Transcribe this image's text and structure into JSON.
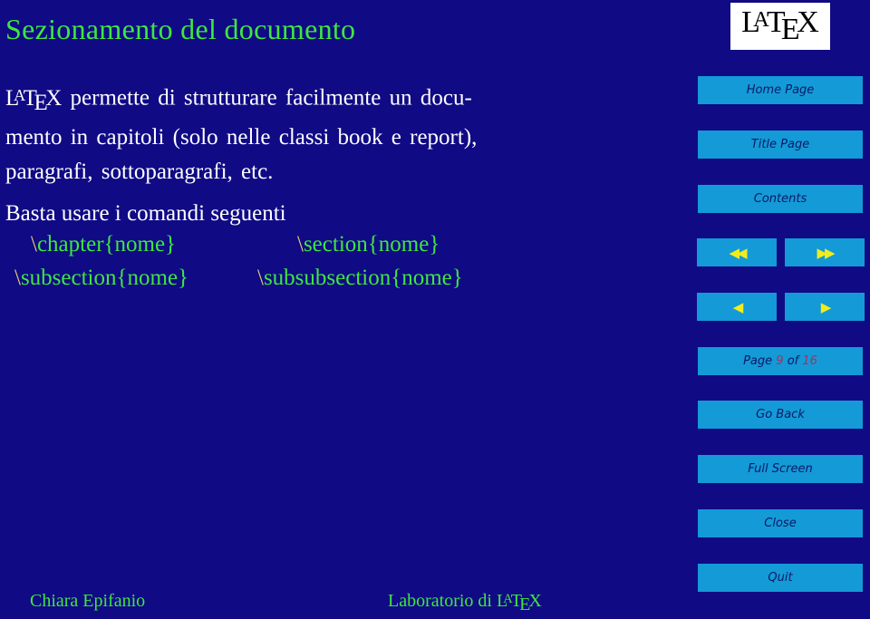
{
  "slide": {
    "title": "Sezionamento del documento",
    "logo": {
      "l": "L",
      "a": "A",
      "t": "T",
      "e": "E",
      "x": "X"
    },
    "paragraph": {
      "line1_rest": " permette di strutturare facilmente un docu-",
      "line2": "mento in capitoli (solo nelle classi book e report),",
      "line3": "paragrafi, sottoparagrafi, etc."
    },
    "intro": "Basta usare i comandi seguenti",
    "commands": [
      {
        "backslash": "\\",
        "name": "chapter{nome}"
      },
      {
        "backslash": "\\",
        "name": "section{nome}"
      },
      {
        "backslash": "\\",
        "name": "subsection{nome}"
      },
      {
        "backslash": "\\",
        "name": "subsubsection{nome}"
      }
    ]
  },
  "navigation": {
    "home": "Home Page",
    "title_page": "Title Page",
    "contents": "Contents",
    "first_icon": "◀◀",
    "last_icon": "▶▶",
    "prev_icon": "◀",
    "next_icon": "▶",
    "page_label": "Page",
    "page_current": "9",
    "page_of": "of",
    "page_total": "16",
    "go_back": "Go Back",
    "full_screen": "Full Screen",
    "close": "Close",
    "quit": "Quit"
  },
  "footer": {
    "author": "Chiara Epifanio",
    "course_prefix": "Laboratorio di "
  },
  "colors": {
    "background": "#100a85",
    "accent_green": "#3fe63f",
    "button_bg": "#149ad7",
    "button_text": "#0b1a66",
    "arrow": "#f2ec1c",
    "page_number": "#a8305e"
  }
}
